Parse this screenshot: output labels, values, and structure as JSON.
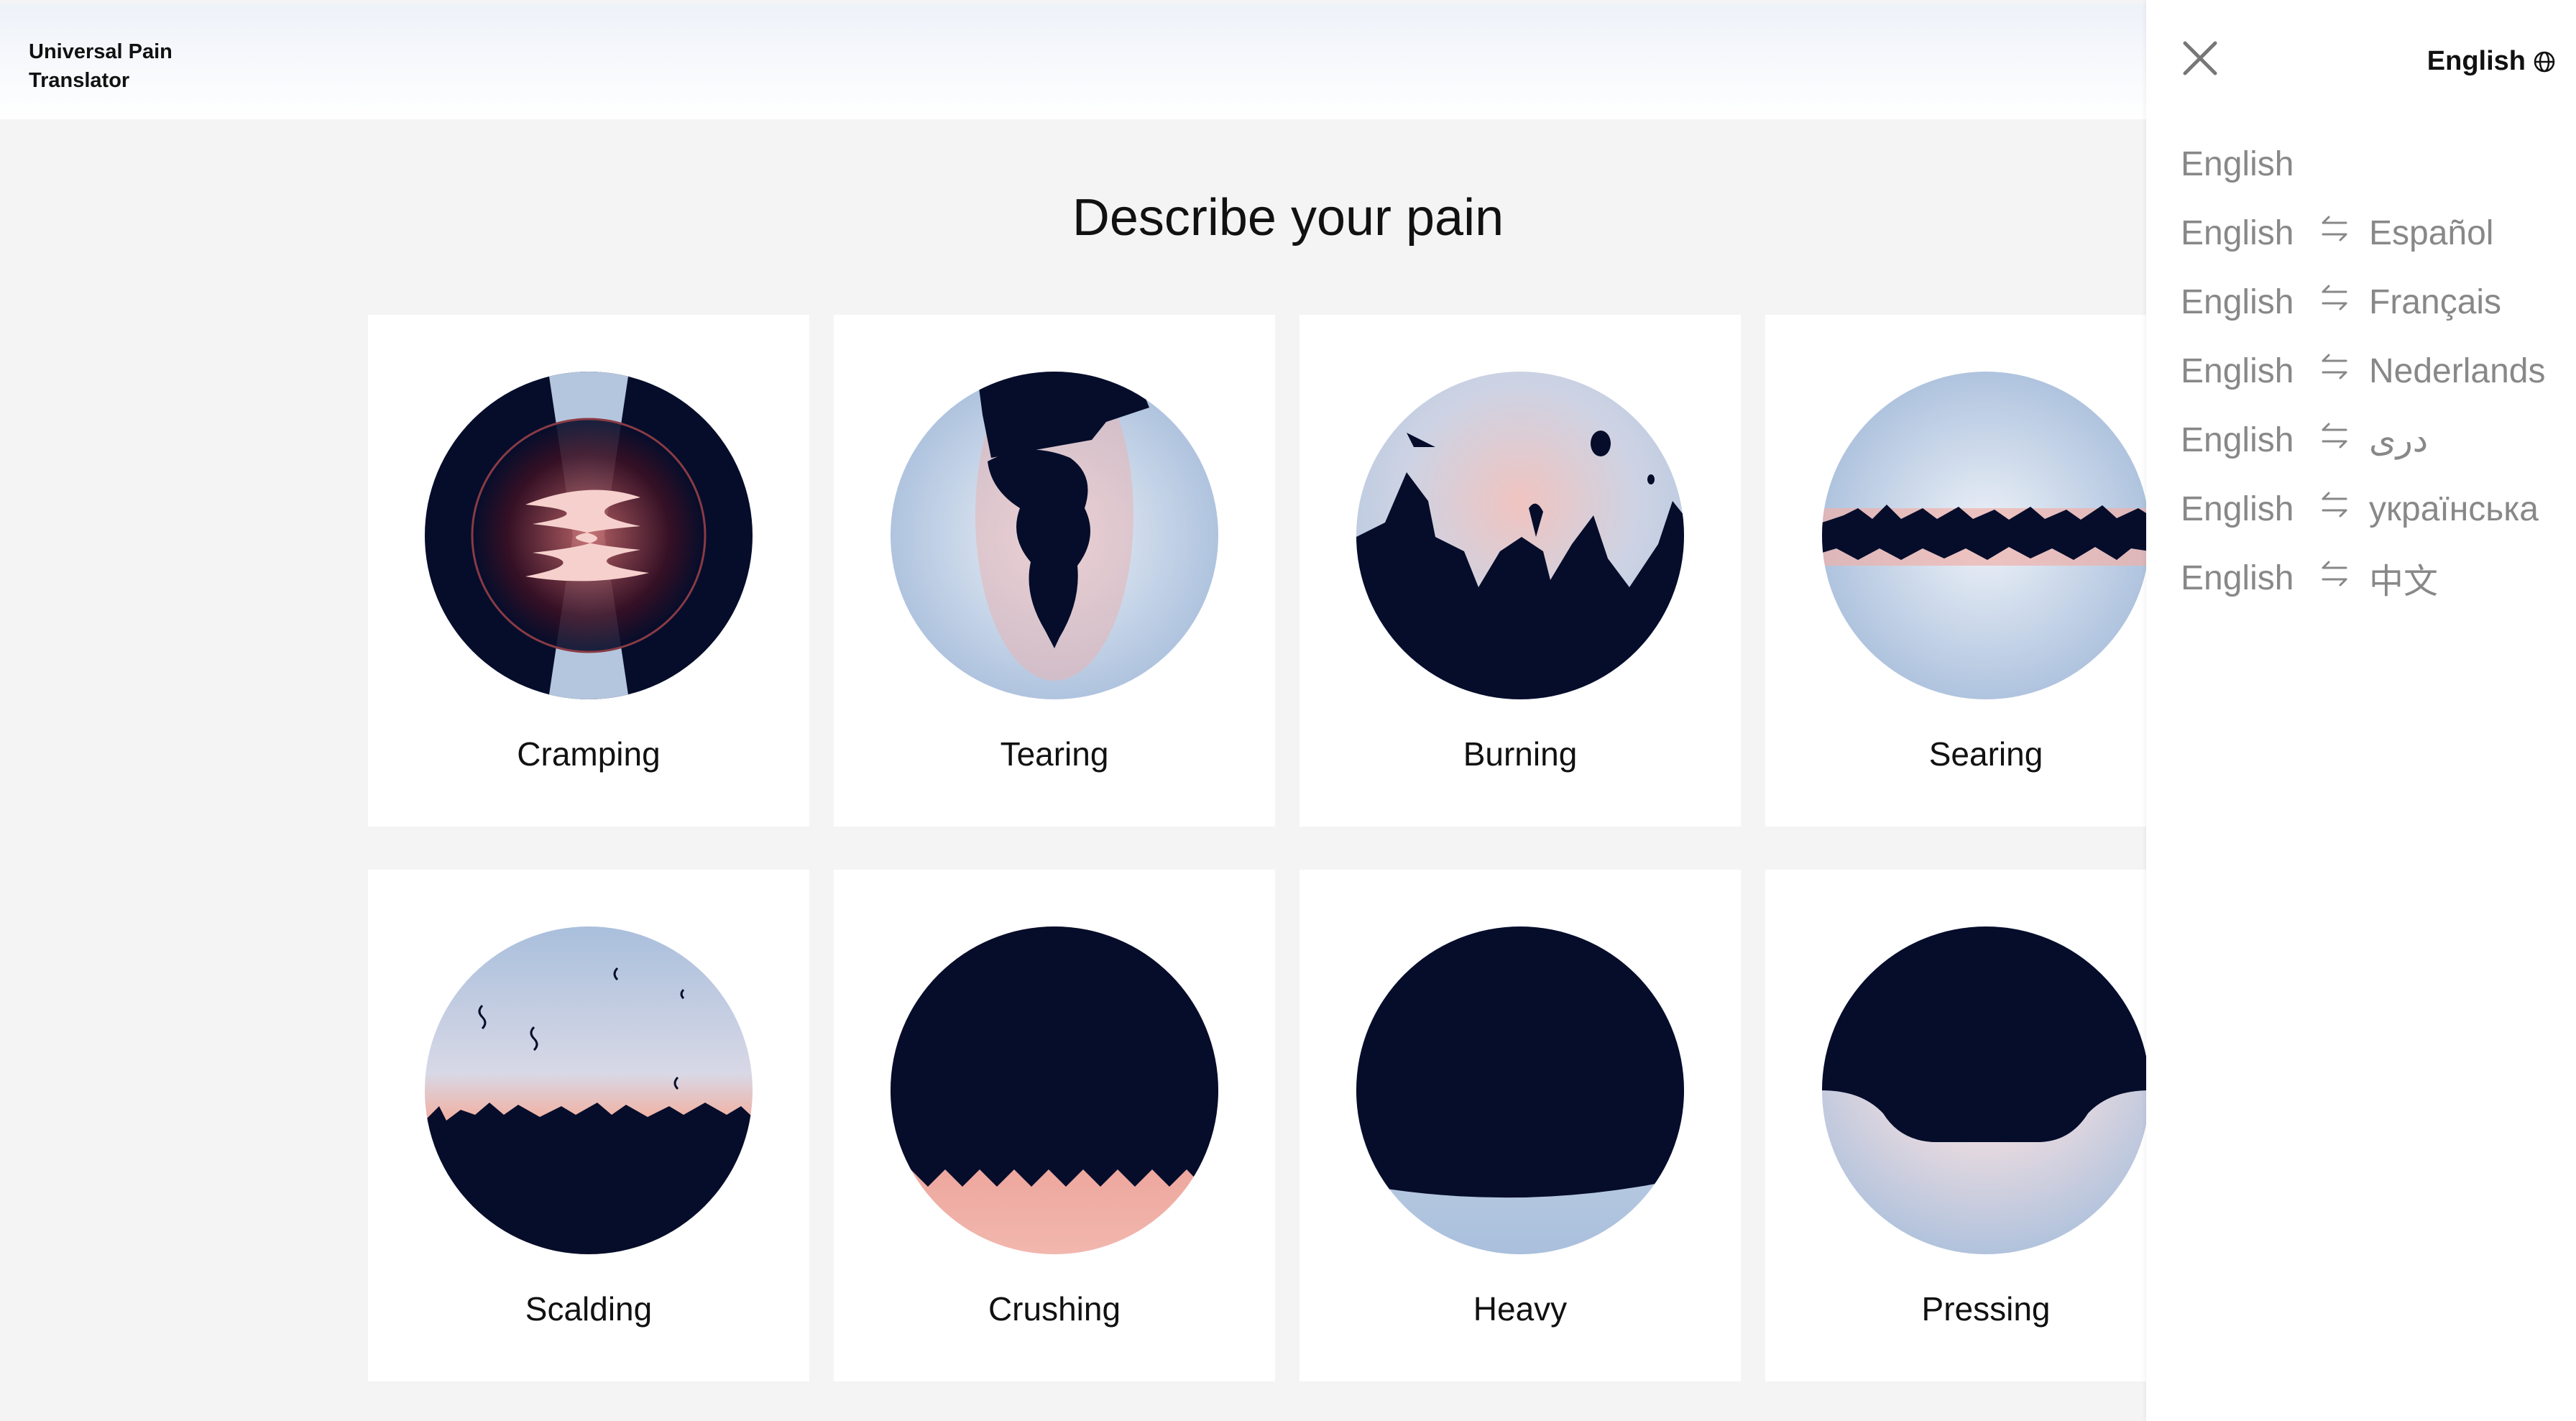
{
  "app": {
    "title_line1": "Universal Pain",
    "title_line2": "Translator"
  },
  "main": {
    "title": "Describe your pain"
  },
  "cards": [
    {
      "label": "Cramping"
    },
    {
      "label": "Tearing"
    },
    {
      "label": "Burning"
    },
    {
      "label": "Searing"
    },
    {
      "label": "Scalding"
    },
    {
      "label": "Crushing"
    },
    {
      "label": "Heavy"
    },
    {
      "label": "Pressing"
    }
  ],
  "panel": {
    "current_language": "English",
    "languages": [
      {
        "from": "English",
        "to": ""
      },
      {
        "from": "English",
        "to": "Español"
      },
      {
        "from": "English",
        "to": "Français"
      },
      {
        "from": "English",
        "to": "Nederlands"
      },
      {
        "from": "English",
        "to": "دری"
      },
      {
        "from": "English",
        "to": "українська"
      },
      {
        "from": "English",
        "to": "中文"
      }
    ]
  },
  "colors": {
    "navy": "#050d2b",
    "sky": "#b4c6dd",
    "pink": "#e8a8a3",
    "coral": "#d9685c"
  },
  "icons": {
    "close": "close-icon",
    "globe": "globe-icon",
    "swap": "swap-arrows-icon"
  }
}
